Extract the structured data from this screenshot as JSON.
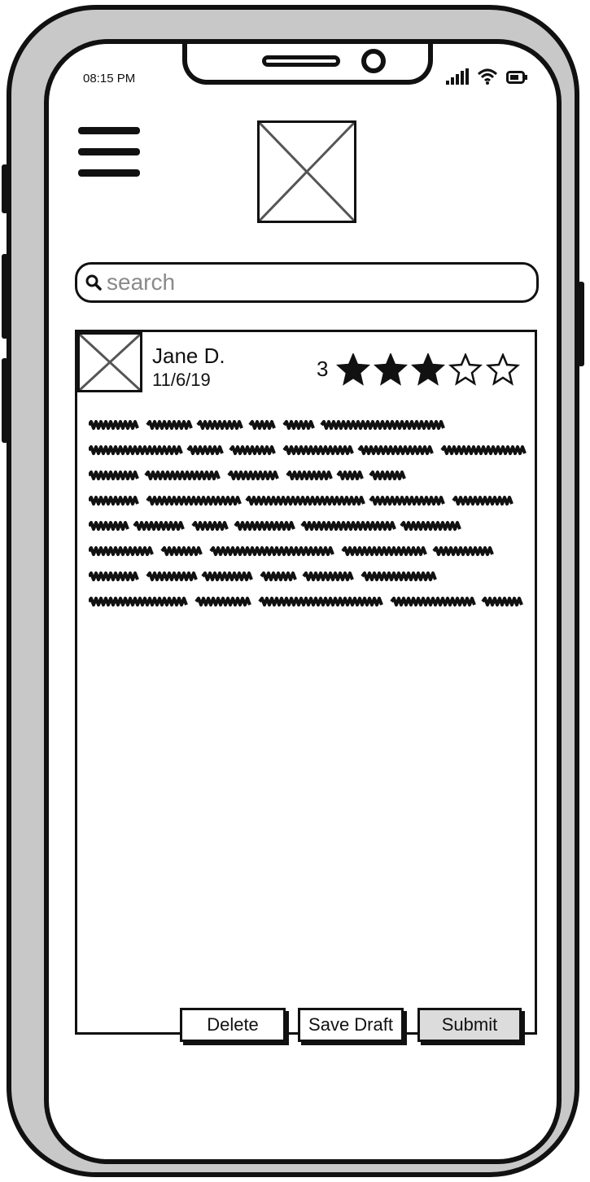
{
  "status_bar": {
    "time": "08:15 PM"
  },
  "header": {
    "menu_icon": "hamburger-menu-icon",
    "logo_icon": "image-placeholder-icon"
  },
  "search": {
    "placeholder": "search",
    "icon": "search-icon"
  },
  "review": {
    "author": "Jane D.",
    "date": "11/6/19",
    "rating": 3,
    "rating_label": "3",
    "max_rating": 5,
    "body_lines": 8
  },
  "actions": {
    "delete_label": "Delete",
    "save_draft_label": "Save Draft",
    "submit_label": "Submit"
  },
  "colors": {
    "frame": "#c8c8c8",
    "ink": "#111111",
    "submit_bg": "#dcdcdc",
    "placeholder": "#8a8a8a"
  }
}
